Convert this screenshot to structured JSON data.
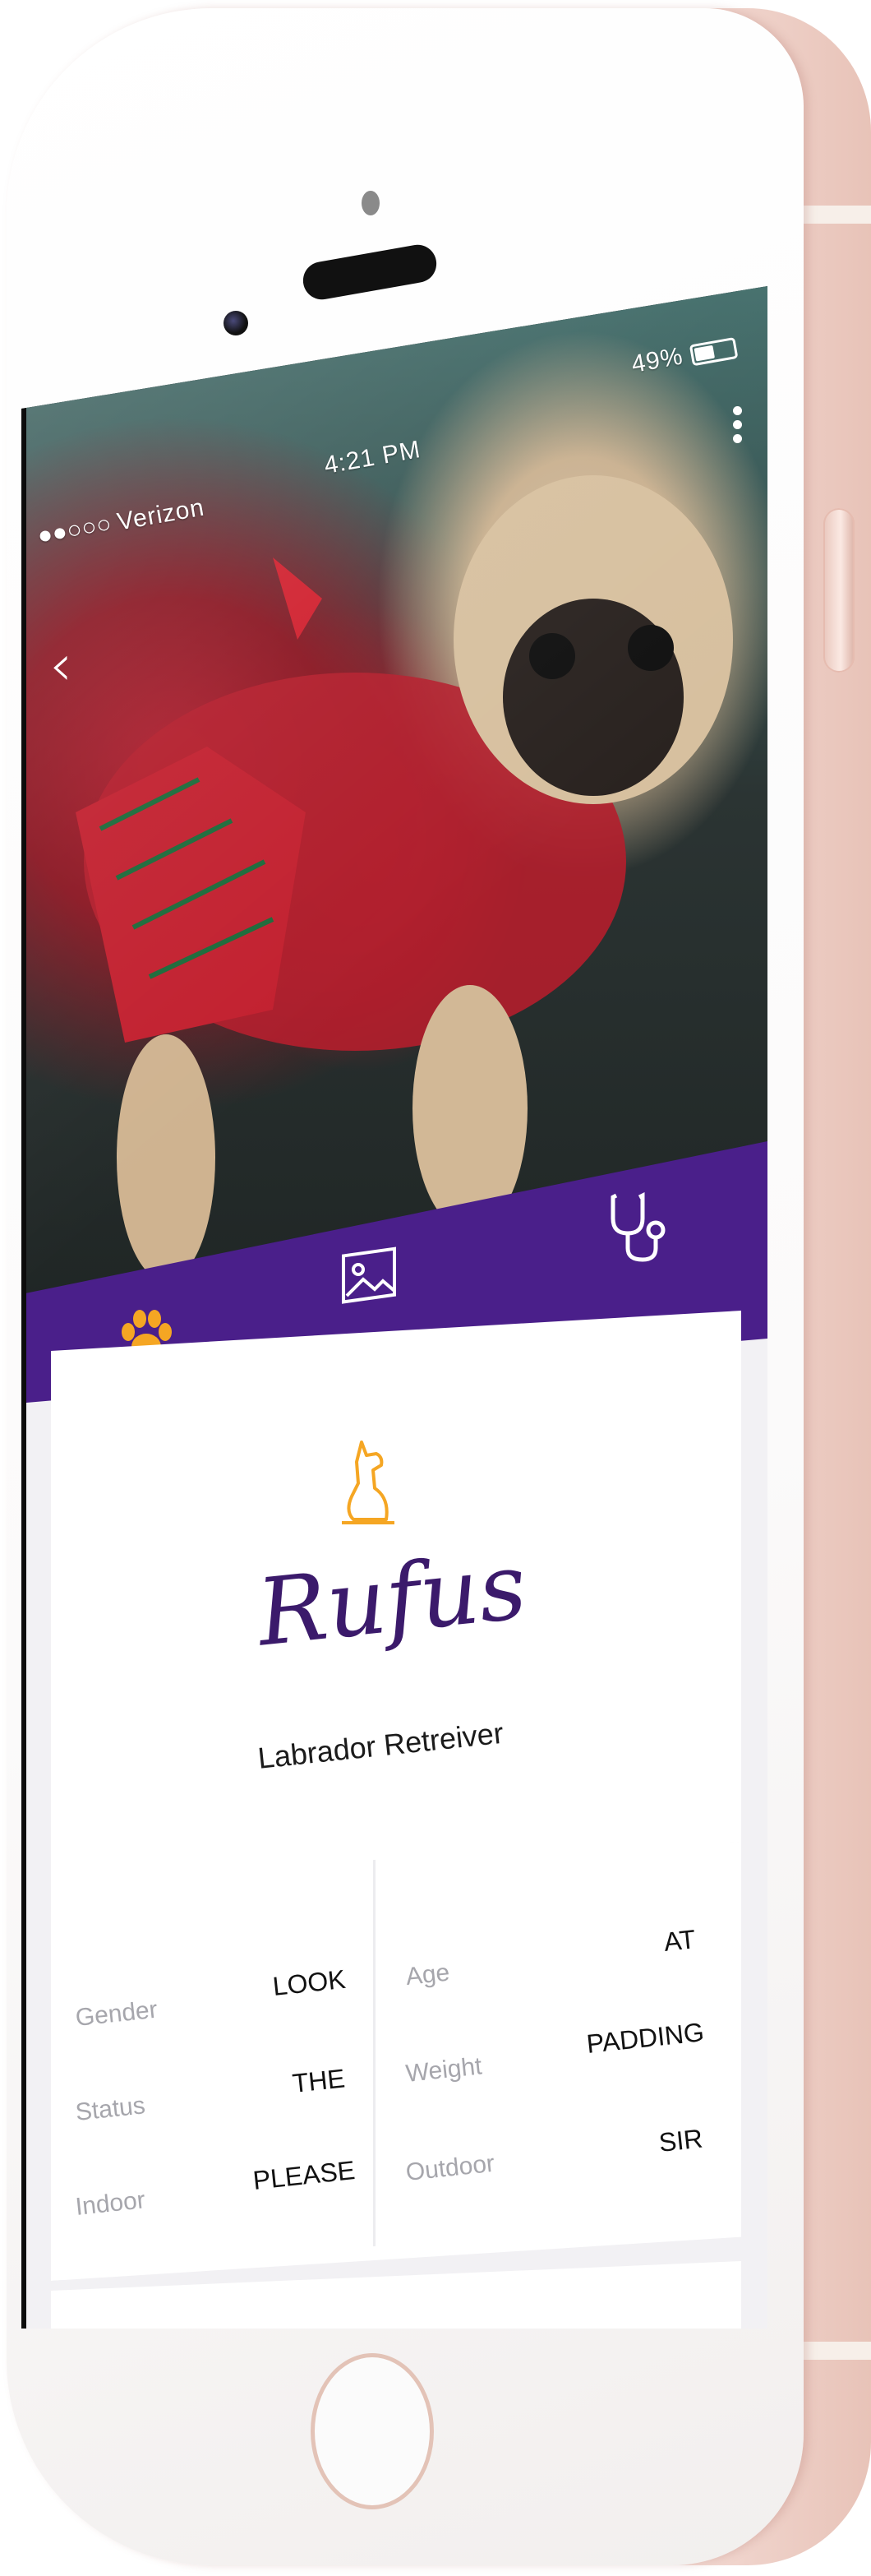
{
  "status_bar": {
    "signal": "●●○○○",
    "carrier": "Verizon",
    "time": "4:21 PM",
    "battery_percent": "49%",
    "battery_level": 0.49
  },
  "icons": {
    "back": "chevron-left-icon",
    "more": "more-vertical-icon",
    "profile_tab": "paw-icon",
    "gallery_tab": "image-icon",
    "vet_tab": "stethoscope-icon",
    "pet_type": "dog-icon"
  },
  "colors": {
    "tab_bar": "#4a1f8a",
    "accent": "#f5a623",
    "name": "#3b1a6b"
  },
  "pet": {
    "name": "Rufus",
    "breed": "Labrador Retreiver"
  },
  "details": {
    "left": [
      {
        "label": "Gender",
        "value": "LOOK"
      },
      {
        "label": "Status",
        "value": "THE"
      },
      {
        "label": "Indoor",
        "value": "PLEASE"
      }
    ],
    "right": [
      {
        "label": "Age",
        "value": "AT"
      },
      {
        "label": "Weight",
        "value": "PADDING"
      },
      {
        "label": "Outdoor",
        "value": "SIR"
      }
    ]
  }
}
